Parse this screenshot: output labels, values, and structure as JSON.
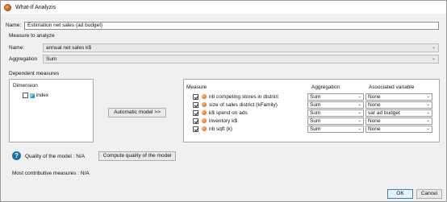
{
  "window": {
    "title": "What-If Analyzis"
  },
  "name_field": {
    "label": "Name:",
    "value": "Estimation net sales (ad budget)"
  },
  "measure_section": {
    "title": "Measure to analyze",
    "name_label": "Name:",
    "name_value": "annual net sales k$",
    "aggregation_label": "Aggregation",
    "aggregation_value": "Sum"
  },
  "dependent": {
    "title": "Dependent measures",
    "dimension_header": "Dimension",
    "dimension_items": [
      {
        "label": "index",
        "checked": false
      }
    ],
    "automatic_button": "Automatic model >>",
    "columns": {
      "measure": "Measure",
      "aggregation": "Aggregation",
      "variable": "Associated variable"
    },
    "rows": [
      {
        "measure": "nb competing stores in district",
        "aggregation": "Sum",
        "variable": "None",
        "checked": true
      },
      {
        "measure": "size of sales district (kFamily)",
        "aggregation": "Sum",
        "variable": "None",
        "checked": true
      },
      {
        "measure": "k$ spend on ads",
        "aggregation": "Sum",
        "variable": "var ad budget",
        "checked": true
      },
      {
        "measure": "inventory k$",
        "aggregation": "Sum",
        "variable": "None",
        "checked": true
      },
      {
        "measure": "nb sqft (k)",
        "aggregation": "Sum",
        "variable": "None",
        "checked": true
      }
    ]
  },
  "quality": {
    "label": "Quality of the model : N/A",
    "compute_button": "Compute quality of the model",
    "help_glyph": "?"
  },
  "most_contributive": "Most contributive measures : N/A",
  "buttons": {
    "ok": "OK",
    "cancel": "Cancel"
  },
  "icons": {
    "app": "what-if-app-icon",
    "help": "help-icon",
    "dimension": "dimension-cube-icon",
    "measure": "measure-dot-icon",
    "dropdown": "chevron-down-icon"
  }
}
